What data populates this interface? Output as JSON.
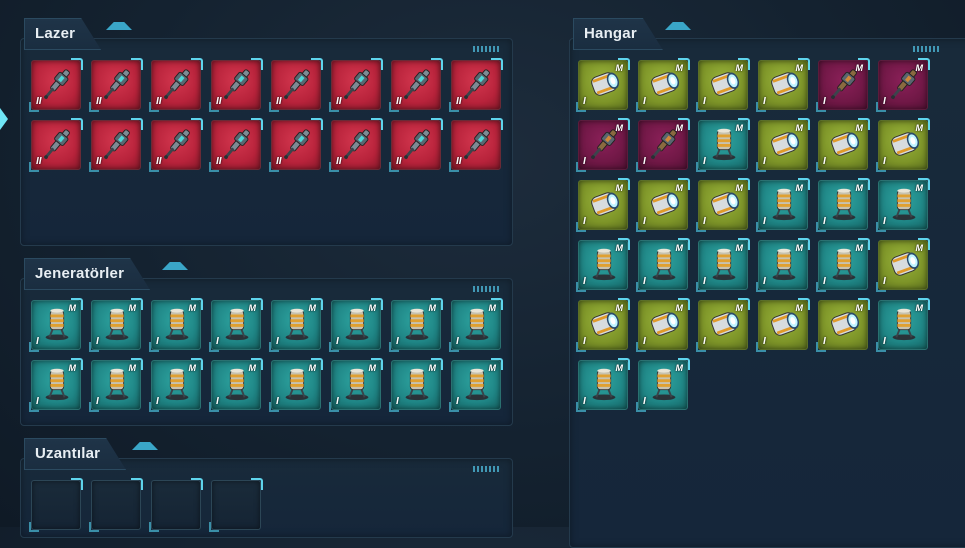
{
  "panels": {
    "lazer": {
      "title": "Lazer"
    },
    "jeneratorler": {
      "title": "Jeneratörler"
    },
    "uzantilar": {
      "title": "Uzantılar"
    },
    "hangar": {
      "title": "Hangar"
    }
  },
  "icons": {
    "laser": "laser-cannon-icon",
    "generator": "shield-generator-icon",
    "speed": "speed-generator-icon"
  },
  "colors": {
    "laser_bg": "#b8233b",
    "generator_bg": "#1f8585",
    "speed_bg": "#7d9428",
    "plum_bg": "#701846",
    "accent": "#5fd4ec"
  },
  "lazer_slots": [
    {
      "type": "laser",
      "level": "II"
    },
    {
      "type": "laser",
      "level": "II"
    },
    {
      "type": "laser",
      "level": "II"
    },
    {
      "type": "laser",
      "level": "II"
    },
    {
      "type": "laser",
      "level": "II"
    },
    {
      "type": "laser",
      "level": "II"
    },
    {
      "type": "laser",
      "level": "II"
    },
    {
      "type": "laser",
      "level": "II"
    },
    {
      "type": "laser",
      "level": "II"
    },
    {
      "type": "laser",
      "level": "II"
    },
    {
      "type": "laser",
      "level": "II"
    },
    {
      "type": "laser",
      "level": "II"
    },
    {
      "type": "laser",
      "level": "II"
    },
    {
      "type": "laser",
      "level": "II"
    },
    {
      "type": "laser",
      "level": "II"
    },
    {
      "type": "laser",
      "level": "II"
    }
  ],
  "jenerator_slots": [
    {
      "type": "generator",
      "level": "I",
      "badge": "M"
    },
    {
      "type": "generator",
      "level": "I",
      "badge": "M"
    },
    {
      "type": "generator",
      "level": "I",
      "badge": "M"
    },
    {
      "type": "generator",
      "level": "I",
      "badge": "M"
    },
    {
      "type": "generator",
      "level": "I",
      "badge": "M"
    },
    {
      "type": "generator",
      "level": "I",
      "badge": "M"
    },
    {
      "type": "generator",
      "level": "I",
      "badge": "M"
    },
    {
      "type": "generator",
      "level": "I",
      "badge": "M"
    },
    {
      "type": "generator",
      "level": "I",
      "badge": "M"
    },
    {
      "type": "generator",
      "level": "I",
      "badge": "M"
    },
    {
      "type": "generator",
      "level": "I",
      "badge": "M"
    },
    {
      "type": "generator",
      "level": "I",
      "badge": "M"
    },
    {
      "type": "generator",
      "level": "I",
      "badge": "M"
    },
    {
      "type": "generator",
      "level": "I",
      "badge": "M"
    },
    {
      "type": "generator",
      "level": "I",
      "badge": "M"
    },
    {
      "type": "generator",
      "level": "I",
      "badge": "M"
    }
  ],
  "uzanti_slots": [
    {
      "type": "empty"
    },
    {
      "type": "empty"
    },
    {
      "type": "empty"
    },
    {
      "type": "empty"
    }
  ],
  "hangar_slots": [
    {
      "type": "speed",
      "level": "I",
      "badge": "M"
    },
    {
      "type": "speed",
      "level": "I",
      "badge": "M"
    },
    {
      "type": "speed",
      "level": "I",
      "badge": "M"
    },
    {
      "type": "speed",
      "level": "I",
      "badge": "M"
    },
    {
      "type": "plumlaser",
      "level": "I",
      "badge": "M"
    },
    {
      "type": "plumlaser",
      "level": "I",
      "badge": "M"
    },
    {
      "type": "plumlaser",
      "level": "I",
      "badge": "M"
    },
    {
      "type": "plumlaser",
      "level": "I",
      "badge": "M"
    },
    {
      "type": "generator",
      "level": "I",
      "badge": "M"
    },
    {
      "type": "speed",
      "level": "I",
      "badge": "M"
    },
    {
      "type": "speed",
      "level": "I",
      "badge": "M"
    },
    {
      "type": "speed",
      "level": "I",
      "badge": "M"
    },
    {
      "type": "speed",
      "level": "I",
      "badge": "M"
    },
    {
      "type": "speed",
      "level": "I",
      "badge": "M"
    },
    {
      "type": "speed",
      "level": "I",
      "badge": "M"
    },
    {
      "type": "generator",
      "level": "I",
      "badge": "M"
    },
    {
      "type": "generator",
      "level": "I",
      "badge": "M"
    },
    {
      "type": "generator",
      "level": "I",
      "badge": "M"
    },
    {
      "type": "generator",
      "level": "I",
      "badge": "M"
    },
    {
      "type": "generator",
      "level": "I",
      "badge": "M"
    },
    {
      "type": "generator",
      "level": "I",
      "badge": "M"
    },
    {
      "type": "generator",
      "level": "I",
      "badge": "M"
    },
    {
      "type": "generator",
      "level": "I",
      "badge": "M"
    },
    {
      "type": "speed",
      "level": "I",
      "badge": "M"
    },
    {
      "type": "speed",
      "level": "I",
      "badge": "M"
    },
    {
      "type": "speed",
      "level": "I",
      "badge": "M"
    },
    {
      "type": "speed",
      "level": "I",
      "badge": "M"
    },
    {
      "type": "speed",
      "level": "I",
      "badge": "M"
    },
    {
      "type": "speed",
      "level": "I",
      "badge": "M"
    },
    {
      "type": "generator",
      "level": "I",
      "badge": "M"
    },
    {
      "type": "generator",
      "level": "I",
      "badge": "M"
    },
    {
      "type": "generator",
      "level": "I",
      "badge": "M"
    }
  ]
}
